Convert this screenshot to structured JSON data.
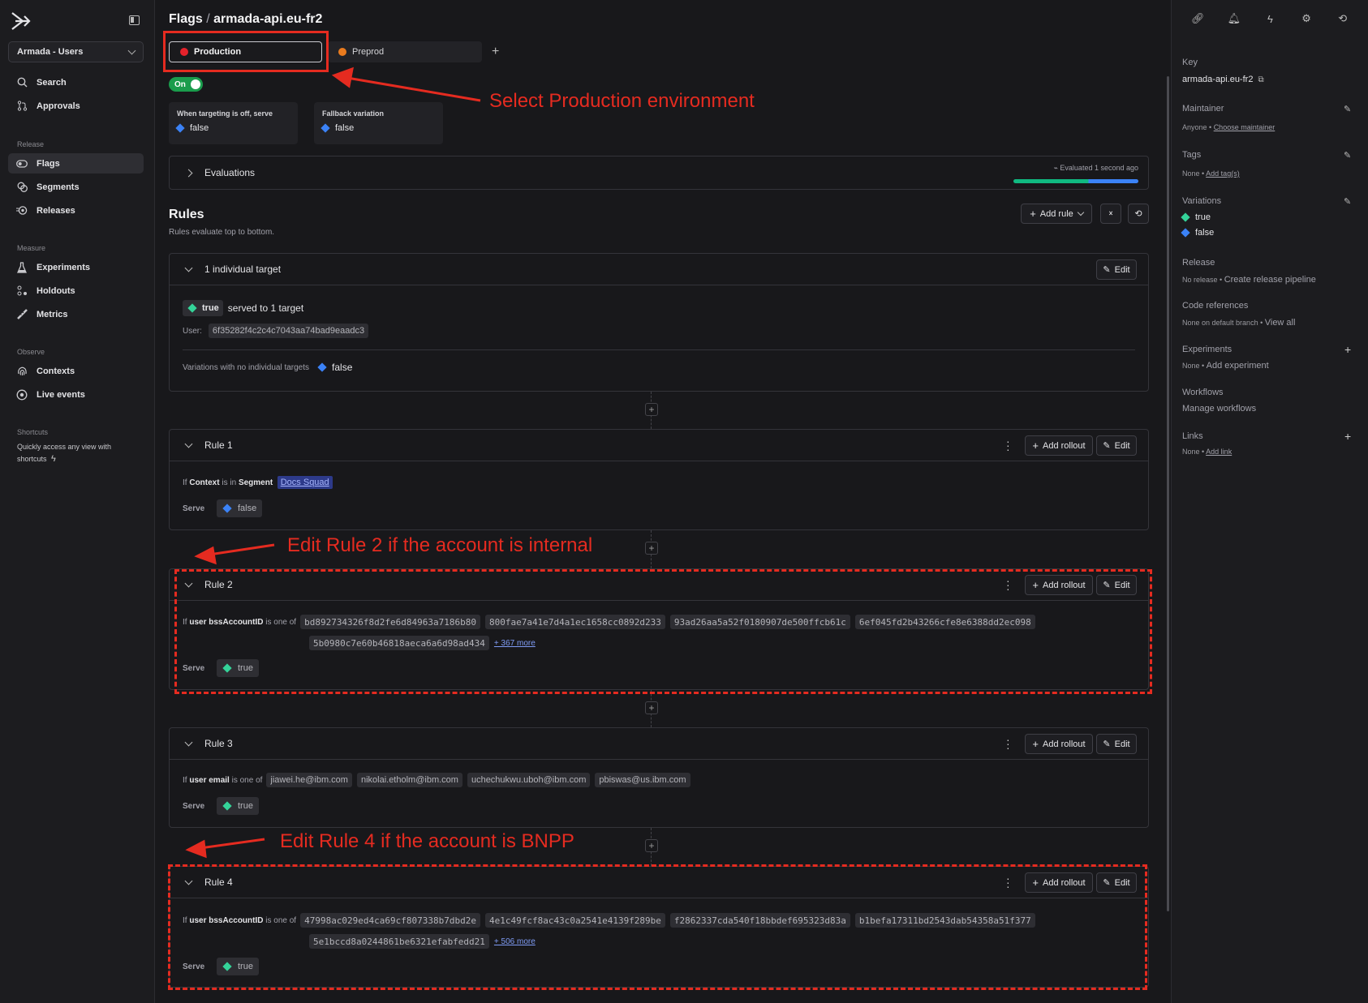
{
  "sidebar": {
    "project": "Armada - Users",
    "top_items": [
      {
        "label": "Search",
        "icon": "search-icon"
      },
      {
        "label": "Approvals",
        "icon": "approvals-icon"
      }
    ],
    "sections": [
      {
        "title": "Release",
        "items": [
          {
            "label": "Flags",
            "icon": "flag-toggle-icon",
            "active": true
          },
          {
            "label": "Segments",
            "icon": "segments-icon"
          },
          {
            "label": "Releases",
            "icon": "releases-icon"
          }
        ]
      },
      {
        "title": "Measure",
        "items": [
          {
            "label": "Experiments",
            "icon": "flask-icon"
          },
          {
            "label": "Holdouts",
            "icon": "holdouts-icon"
          },
          {
            "label": "Metrics",
            "icon": "ruler-icon"
          }
        ]
      },
      {
        "title": "Observe",
        "items": [
          {
            "label": "Contexts",
            "icon": "fingerprint-icon"
          },
          {
            "label": "Live events",
            "icon": "live-events-icon"
          }
        ]
      }
    ],
    "shortcuts_title": "Shortcuts",
    "shortcuts_text": "Quickly access any view with shortcuts"
  },
  "header": {
    "breadcrumb_root": "Flags",
    "separator": "/",
    "flag_key": "armada-api.eu-fr2"
  },
  "environments": [
    {
      "label": "Production",
      "color": "#e5222b",
      "selected": true
    },
    {
      "label": "Preprod",
      "color": "#ea7b1e",
      "selected": false
    }
  ],
  "targeting_toggle": "On",
  "off_serve": {
    "label": "When targeting is off, serve",
    "value": "false"
  },
  "fallback": {
    "label": "Fallback variation",
    "value": "false"
  },
  "evaluations": {
    "title": "Evaluations",
    "status": "Evaluated 1 second ago"
  },
  "rules_header": {
    "title": "Rules",
    "subtitle": "Rules evaluate top to bottom.",
    "add_rule": "Add rule"
  },
  "buttons": {
    "edit": "Edit",
    "add_rollout": "Add rollout"
  },
  "individual_target": {
    "title": "1 individual target",
    "variation": "true",
    "served_text": "served to 1 target",
    "user_label": "User:",
    "user_id": "6f35282f4c2c4c7043aa74bad9eaadc3",
    "no_targets_label": "Variations with no individual targets",
    "no_targets_value": "false"
  },
  "rules": [
    {
      "title": "Rule 1",
      "cond_if": "If",
      "cond_attr": "Context",
      "cond_op": "is in",
      "cond_kind": "Segment",
      "segment": "Docs Squad",
      "serve_label": "Serve",
      "serve": "false"
    },
    {
      "title": "Rule 2",
      "cond_if": "If",
      "cond_attr": "user bssAccountID",
      "cond_op": "is one of",
      "values": [
        "bd892734326f8d2fe6d84963a7186b80",
        "800fae7a41e7d4a1ec1658cc0892d233",
        "93ad26aa5a52f0180907de500ffcb61c",
        "6ef045fd2b43266cfe8e6388dd2ec098",
        "5b0980c7e60b46818aeca6a6d98ad434"
      ],
      "more": "+ 367 more",
      "serve_label": "Serve",
      "serve": "true"
    },
    {
      "title": "Rule 3",
      "cond_if": "If",
      "cond_attr": "user email",
      "cond_op": "is one of",
      "values": [
        "jiawei.he@ibm.com",
        "nikolai.etholm@ibm.com",
        "uchechukwu.uboh@ibm.com",
        "pbiswas@us.ibm.com"
      ],
      "serve_label": "Serve",
      "serve": "true"
    },
    {
      "title": "Rule 4",
      "cond_if": "If",
      "cond_attr": "user bssAccountID",
      "cond_op": "is one of",
      "values": [
        "47998ac029ed4ca69cf807338b7dbd2e",
        "4e1c49fcf8ac43c0a2541e4139f289be",
        "f2862337cda540f18bbdef695323d83a",
        "b1befa17311bd2543dab54358a51f377",
        "5e1bccd8a0244861be6321efabfedd21"
      ],
      "more": "+ 506 more",
      "serve_label": "Serve",
      "serve": "true"
    }
  ],
  "right_panel": {
    "key_label": "Key",
    "key_value": "armada-api.eu-fr2",
    "maintainer_label": "Maintainer",
    "maintainer_value": "Anyone",
    "maintainer_link": "Choose maintainer",
    "tags_label": "Tags",
    "tags_value": "None",
    "tags_link": "Add tag(s)",
    "variations_label": "Variations",
    "variations": [
      "true",
      "false"
    ],
    "release_label": "Release",
    "release_value": "No release",
    "release_link": "Create release pipeline",
    "coderefs_label": "Code references",
    "coderefs_value": "None on default branch",
    "coderefs_link": "View all",
    "experiments_label": "Experiments",
    "experiments_value": "None",
    "experiments_link": "Add experiment",
    "workflows_label": "Workflows",
    "workflows_link": "Manage workflows",
    "links_label": "Links",
    "links_value": "None",
    "links_link": "Add link"
  },
  "annotations": {
    "a1": "Select Production environment",
    "a2": "Edit Rule 2 if the account is internal",
    "a3": "Edit Rule 4 if the account is BNPP",
    "color": "#e52b20"
  },
  "colors": {
    "true": "#34d399",
    "false": "#3b82f6",
    "toggle_on": "#1a9c4c"
  }
}
